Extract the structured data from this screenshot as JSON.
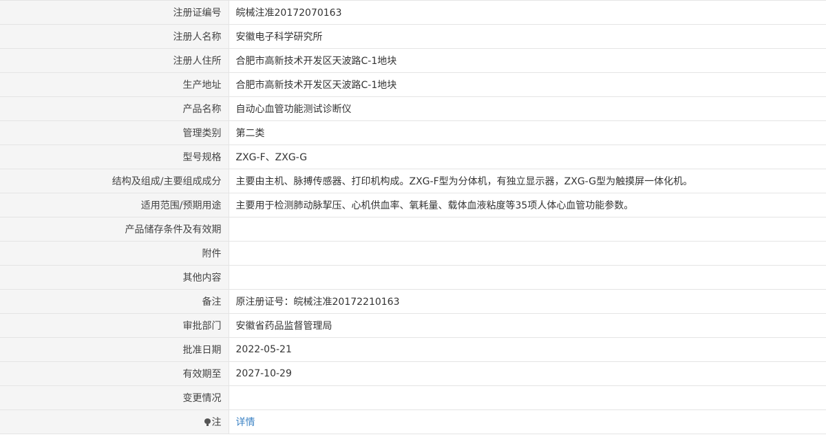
{
  "rows": [
    {
      "label": "注册证编号",
      "value": "皖械注准20172070163"
    },
    {
      "label": "注册人名称",
      "value": "安徽电子科学研究所"
    },
    {
      "label": "注册人住所",
      "value": "合肥市高新技术开发区天波路C-1地块"
    },
    {
      "label": "生产地址",
      "value": "合肥市高新技术开发区天波路C-1地块"
    },
    {
      "label": "产品名称",
      "value": "自动心血管功能测试诊断仪"
    },
    {
      "label": "管理类别",
      "value": "第二类"
    },
    {
      "label": "型号规格",
      "value": "ZXG-F、ZXG-G"
    },
    {
      "label": "结构及组成/主要组成成分",
      "value": "主要由主机、脉搏传感器、打印机构成。ZXG-F型为分体机，有独立显示器，ZXG-G型为触摸屏一体化机。"
    },
    {
      "label": "适用范围/预期用途",
      "value": "主要用于检测肺动脉挈压、心机供血率、氧耗量、载体血液粘度等35项人体心血管功能参数。"
    },
    {
      "label": "产品储存条件及有效期",
      "value": ""
    },
    {
      "label": "附件",
      "value": ""
    },
    {
      "label": "其他内容",
      "value": ""
    },
    {
      "label": "备注",
      "value": "原注册证号：皖械注准20172210163"
    },
    {
      "label": "审批部门",
      "value": "安徽省药品监督管理局"
    },
    {
      "label": "批准日期",
      "value": "2022-05-21"
    },
    {
      "label": "有效期至",
      "value": "2027-10-29"
    },
    {
      "label": "变更情况",
      "value": ""
    }
  ],
  "note": {
    "label": "注",
    "icon": "lightbulb-icon",
    "link_text": "详情",
    "link_color": "#3b82c4"
  },
  "colors": {
    "label_background": "#f5f5f5",
    "border": "#e4e4e4",
    "text": "#333333"
  }
}
